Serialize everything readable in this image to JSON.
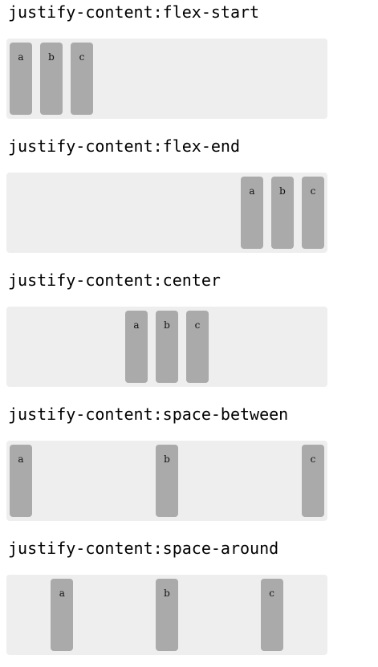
{
  "demos": [
    {
      "title": "justify-content:flex-start",
      "items": [
        "a",
        "b",
        "c"
      ]
    },
    {
      "title": "justify-content:flex-end",
      "items": [
        "a",
        "b",
        "c"
      ]
    },
    {
      "title": "justify-content:center",
      "items": [
        "a",
        "b",
        "c"
      ]
    },
    {
      "title": "justify-content:space-between",
      "items": [
        "a",
        "b",
        "c"
      ]
    },
    {
      "title": "justify-content:space-around",
      "items": [
        "a",
        "b",
        "c"
      ]
    }
  ],
  "colors": {
    "container_bg": "#eeeeee",
    "item_bg": "#aaaaaa",
    "text": "#000000"
  }
}
